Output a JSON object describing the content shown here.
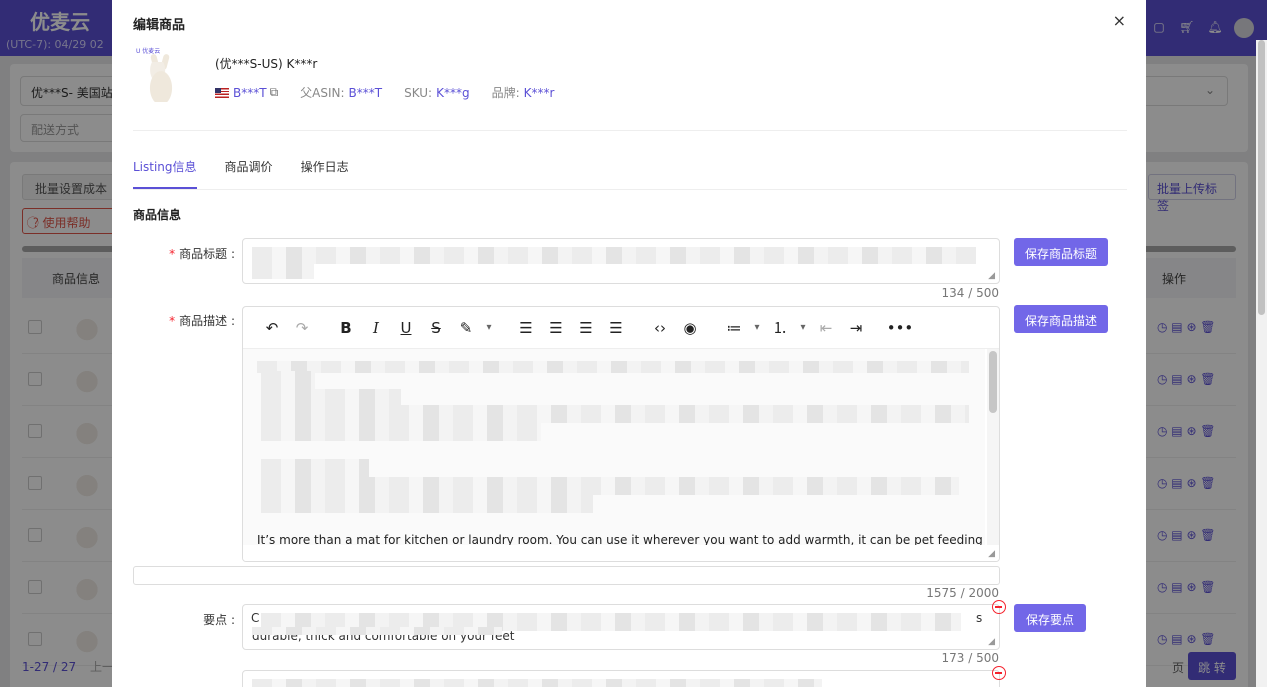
{
  "background_app": {
    "logo": "优麦云",
    "clock": "(UTC-7): 04/29 02",
    "store_select": "优***S- 美国站",
    "delivery_select_placeholder": "配送方式",
    "batch_cost_label": "批量设置成本",
    "help_label": "使用帮助",
    "batch_upload_label": "批量上传标签",
    "col_product_info": "商品信息",
    "col_actions": "操作",
    "pager_range": "1-27 / 27",
    "pager_prev": "上一",
    "page_label": "页",
    "jump_label": "跳 转"
  },
  "modal": {
    "title": "编辑商品",
    "close_label": "×",
    "product": {
      "name": "(优***S-US) K***r",
      "image_brand": "U 优麦云",
      "asin": "B***T",
      "parent_asin_label": "父ASIN:",
      "parent_asin": "B***T",
      "sku_label": "SKU:",
      "sku": "K***g",
      "brand_label": "品牌:",
      "brand": "K***r"
    },
    "tabs": [
      {
        "label": "Listing信息"
      },
      {
        "label": "商品调价"
      },
      {
        "label": "操作日志"
      }
    ],
    "section_title": "商品信息",
    "fields": {
      "title_label": "商品标题 :",
      "title_counter": "134 / 500",
      "save_title": "保存商品标题",
      "desc_label": "商品描述 :",
      "save_desc": "保存商品描述",
      "desc_visible_text": "It’s more than a mat for kitchen or laundry room. You can use it wherever you want to add warmth, it can be pet feeding mat",
      "desc_counter": "1575 / 2000",
      "points_label": "要点 :",
      "points_text_start": "C",
      "points_text_end": "s",
      "points_line2": "durable, thick and comfortable on your feet",
      "points_counter": "173 / 500",
      "save_points": "保存要点"
    }
  }
}
